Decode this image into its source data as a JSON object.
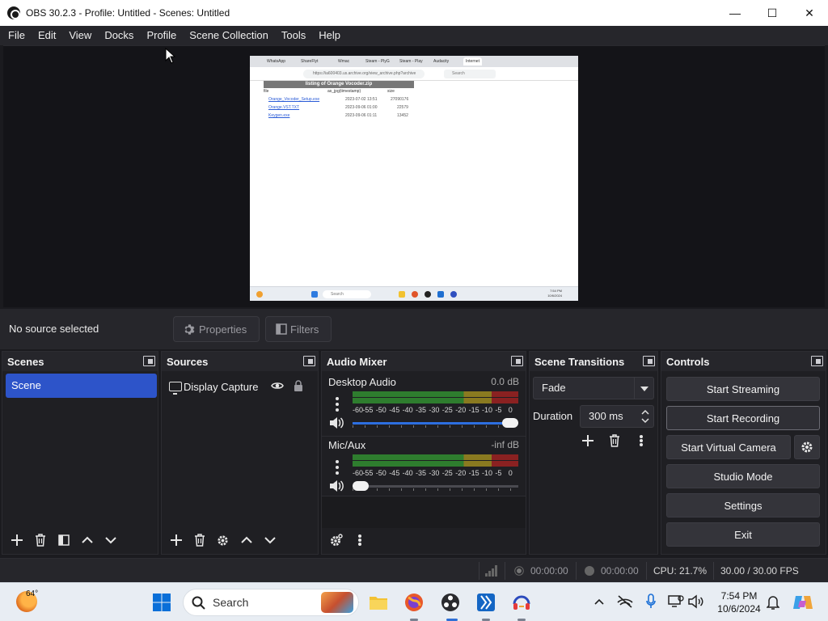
{
  "window": {
    "title": "OBS 30.2.3 - Profile: Untitled - Scenes: Untitled",
    "minimize": "—",
    "maximize": "☐",
    "close": "✕"
  },
  "menu": [
    "File",
    "Edit",
    "View",
    "Docks",
    "Profile",
    "Scene Collection",
    "Tools",
    "Help"
  ],
  "preview": {
    "tabs": [
      "WhatsApp",
      "ShareFlyt",
      "Wmac",
      "Steam - PlyG",
      "Steam - Play",
      "Audacity",
      "Internet"
    ],
    "url": "https://ia600403.us.archive.org/view_archive.php?archive",
    "search_placeholder": "Search",
    "page_heading": "listing of Orange Vocoder.zip",
    "columns": [
      "file",
      "as_jpg(timestamp)",
      "size"
    ],
    "rows": [
      {
        "file": "Orange_Vocoder_Setup.exe",
        "date": "2023-07-02 13:51",
        "size": "27090176"
      },
      {
        "file": "Orange.VST.TXT",
        "date": "2023-09-06 01:00",
        "size": "22579"
      },
      {
        "file": "Keygen.exe",
        "date": "2023-09-06 01:11",
        "size": "13452"
      }
    ],
    "taskbar_search": "Search",
    "taskbar_time": "7:54 PM",
    "taskbar_date": "10/6/2024"
  },
  "context_bar": {
    "status": "No source selected",
    "properties_label": "Properties",
    "filters_label": "Filters"
  },
  "scenes": {
    "title": "Scenes",
    "items": [
      "Scene"
    ]
  },
  "sources": {
    "title": "Sources",
    "items": [
      "Display Capture"
    ]
  },
  "audio_mixer": {
    "title": "Audio Mixer",
    "scale": [
      "-60",
      "-55",
      "-50",
      "-45",
      "-40",
      "-35",
      "-30",
      "-25",
      "-20",
      "-15",
      "-10",
      "-5",
      "0"
    ],
    "channels": [
      {
        "name": "Desktop Audio",
        "db": "0.0 dB",
        "volume": 1.0
      },
      {
        "name": "Mic/Aux",
        "db": "-inf dB",
        "volume": 0.0
      }
    ]
  },
  "scene_transitions": {
    "title": "Scene Transitions",
    "selected": "Fade",
    "duration_label": "Duration",
    "duration_value": "300 ms"
  },
  "controls": {
    "title": "Controls",
    "start_streaming": "Start Streaming",
    "start_recording": "Start Recording",
    "start_virtual_camera": "Start Virtual Camera",
    "studio_mode": "Studio Mode",
    "settings": "Settings",
    "exit": "Exit"
  },
  "status_bar": {
    "stream_time": "00:00:00",
    "record_time": "00:00:00",
    "cpu": "CPU: 21.7%",
    "fps": "30.00 / 30.00 FPS"
  },
  "taskbar": {
    "temperature": "64°",
    "search_placeholder": "Search",
    "time": "7:54 PM",
    "date": "10/6/2024"
  },
  "colors": {
    "accent": "#2d54c9",
    "meter_green": "#2e7d2e",
    "meter_yellow": "#8a7a20",
    "meter_red": "#8a2121"
  }
}
